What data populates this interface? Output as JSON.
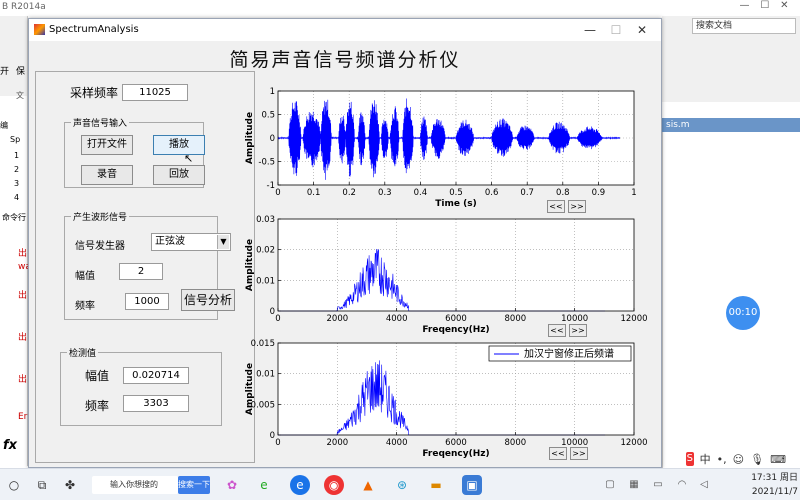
{
  "background": {
    "app_title": "B R2014a",
    "search_placeholder": "搜索文档",
    "file_tab": "sis.m",
    "left_labels": [
      "开",
      "保",
      "文",
      "编",
      "Sp",
      "1",
      "2",
      "3",
      "4",
      "命令行",
      "出",
      "wa",
      "出",
      "出",
      "出",
      "Er"
    ],
    "timer": "00:10"
  },
  "window": {
    "title": "SpectrumAnalysis",
    "main_title": "简易声音信号频谱分析仪"
  },
  "controls": {
    "sample_rate_label": "采样频率",
    "sample_rate_value": "11025",
    "input_group_title": "声音信号输入",
    "open_file": "打开文件",
    "play": "播放",
    "record": "录音",
    "playback": "回放",
    "gen_group_title": "产生波形信号",
    "generator_label": "信号发生器",
    "generator_value": "正弦波",
    "amplitude_label": "幅值",
    "amplitude_value": "2",
    "frequency_label": "频率",
    "frequency_value": "1000",
    "analyze": "信号分析",
    "detect_group_title": "检测值",
    "detect_amp_label": "幅值",
    "detect_amp_value": "0.020714",
    "detect_freq_label": "频率",
    "detect_freq_value": "3303"
  },
  "nav": {
    "prev": "<<",
    "next": ">>"
  },
  "chart_data": [
    {
      "type": "line",
      "title": "",
      "xlabel": "Time (s)",
      "ylabel": "Amplitude",
      "xlim": [
        0,
        1
      ],
      "ylim": [
        -1,
        1
      ],
      "xticks": [
        "0",
        "0.1",
        "0.2",
        "0.3",
        "0.4",
        "0.5",
        "0.6",
        "0.7",
        "0.8",
        "0.9",
        "1"
      ],
      "yticks": [
        "1",
        "0.5",
        "0",
        "-0.5",
        "-1"
      ],
      "grid": true,
      "color": "#0000ff",
      "series": [
        {
          "name": "",
          "bursts": [
            {
              "t0": 0.03,
              "t1": 0.065,
              "amp": 0.85
            },
            {
              "t0": 0.07,
              "t1": 0.12,
              "amp": 0.65
            },
            {
              "t0": 0.12,
              "t1": 0.15,
              "amp": 0.9
            },
            {
              "t0": 0.17,
              "t1": 0.19,
              "amp": 0.55
            },
            {
              "t0": 0.19,
              "t1": 0.215,
              "amp": 0.85
            },
            {
              "t0": 0.225,
              "t1": 0.245,
              "amp": 0.6
            },
            {
              "t0": 0.255,
              "t1": 0.285,
              "amp": 0.9
            },
            {
              "t0": 0.29,
              "t1": 0.31,
              "amp": 0.5
            },
            {
              "t0": 0.315,
              "t1": 0.34,
              "amp": 0.7
            },
            {
              "t0": 0.35,
              "t1": 0.38,
              "amp": 0.9
            },
            {
              "t0": 0.4,
              "t1": 0.42,
              "amp": 0.5
            },
            {
              "t0": 0.43,
              "t1": 0.47,
              "amp": 0.45
            },
            {
              "t0": 0.5,
              "t1": 0.55,
              "amp": 0.4
            },
            {
              "t0": 0.6,
              "t1": 0.66,
              "amp": 0.42
            },
            {
              "t0": 0.67,
              "t1": 0.72,
              "amp": 0.28
            },
            {
              "t0": 0.76,
              "t1": 0.82,
              "amp": 0.35
            },
            {
              "t0": 0.84,
              "t1": 0.91,
              "amp": 0.25
            }
          ],
          "tail_end": 0.96
        }
      ]
    },
    {
      "type": "line",
      "title": "",
      "xlabel": "Freqency(Hz)",
      "ylabel": "Amplitude",
      "xlim": [
        0,
        12000
      ],
      "ylim": [
        0,
        0.03
      ],
      "xticks": [
        "0",
        "2000",
        "4000",
        "6000",
        "8000",
        "10000",
        "12000"
      ],
      "yticks": [
        "0.03",
        "0.02",
        "0.01",
        "0"
      ],
      "grid": true,
      "color": "#0000ff",
      "series": [
        {
          "name": "",
          "peak_hz": 3303,
          "peak": 0.021,
          "band": [
            2000,
            4400
          ],
          "floor_end": 11025
        }
      ]
    },
    {
      "type": "line",
      "title": "",
      "xlabel": "Freqency(Hz)",
      "ylabel": "Amplitude",
      "xlim": [
        0,
        12000
      ],
      "ylim": [
        0,
        0.015
      ],
      "xticks": [
        "0",
        "2000",
        "4000",
        "6000",
        "8000",
        "10000",
        "12000"
      ],
      "yticks": [
        "0.015",
        "0.01",
        "0.005",
        "0"
      ],
      "grid": true,
      "color": "#0000ff",
      "legend": "加汉宁窗修正后频谱",
      "legend_position": "top-right",
      "series": [
        {
          "name": "加汉宁窗修正后频谱",
          "peak_hz": 3303,
          "peak": 0.0127,
          "band": [
            2000,
            4400
          ],
          "floor_end": 11025
        }
      ]
    }
  ],
  "taskbar": {
    "search_text": "输入你想搜的",
    "search_button": "搜索一下",
    "time": "17:31 周日",
    "date": "2021/11/7",
    "ime_label": "中"
  }
}
